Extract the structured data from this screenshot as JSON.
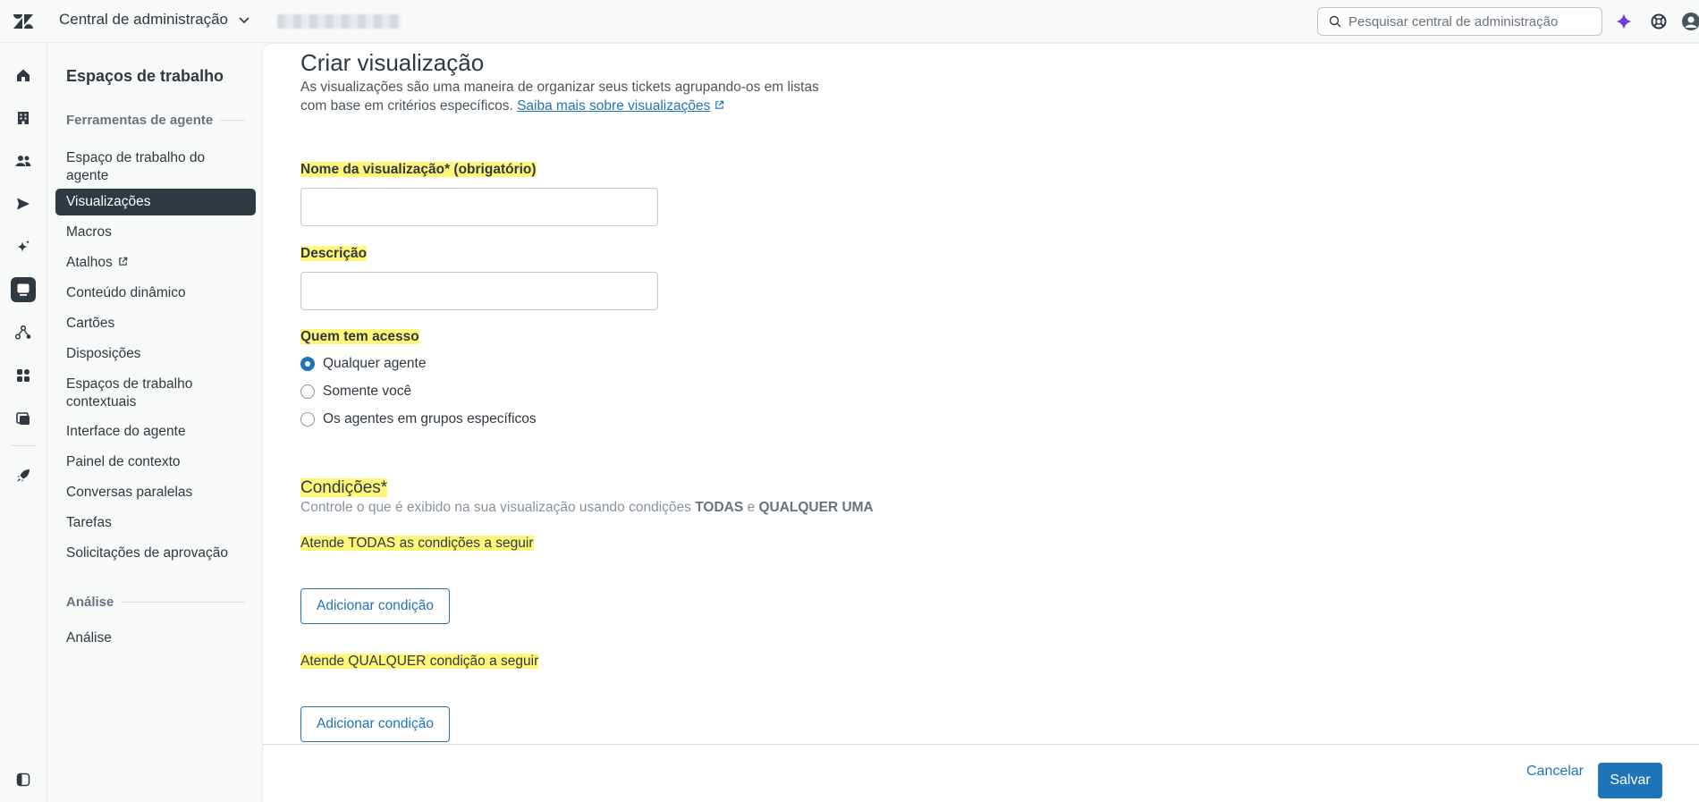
{
  "header": {
    "product_name": "Central de administração",
    "search_placeholder": "Pesquisar central de administração"
  },
  "rail": {
    "items": [
      "home-icon",
      "building-icon",
      "people-icon",
      "send-icon",
      "sparkle-icon",
      "workspaces-icon",
      "objects-icon",
      "apps-icon",
      "account-icon",
      "rocket-icon"
    ],
    "active": "workspaces-icon"
  },
  "sidebar": {
    "title": "Espaços de trabalho",
    "section_agent_tools": "Ferramentas de agente",
    "items": [
      {
        "label": "Espaço de trabalho do agente"
      },
      {
        "label": "Visualizações"
      },
      {
        "label": "Macros"
      },
      {
        "label": "Atalhos"
      },
      {
        "label": "Conteúdo dinâmico"
      },
      {
        "label": "Cartões"
      },
      {
        "label": "Disposições"
      },
      {
        "label": "Espaços de trabalho contextuais"
      },
      {
        "label": "Interface do agente"
      },
      {
        "label": "Painel de contexto"
      },
      {
        "label": "Conversas paralelas"
      },
      {
        "label": "Tarefas"
      },
      {
        "label": "Solicitações de aprovação"
      }
    ],
    "section_analysis": "Análise",
    "analysis_items": [
      {
        "label": "Análise"
      }
    ]
  },
  "main": {
    "title": "Criar visualização",
    "intro_text": "As visualizações são uma maneira de organizar seus tickets agrupando-os em listas com base em critérios específicos.",
    "intro_link": "Saiba mais sobre visualizações",
    "name_label": "Nome da visualização* (obrigatório)",
    "name_value": "",
    "description_label": "Descrição",
    "description_value": "",
    "access_label": "Quem tem acesso",
    "access_options": [
      "Qualquer agente",
      "Somente você",
      "Os agentes em grupos específicos"
    ],
    "access_selected": "Qualquer agente",
    "conditions_title": "Condições*",
    "conditions_desc_pre": "Controle o que é exibido na sua visualização usando condições",
    "conditions_desc_all": "TODAS",
    "conditions_desc_and": "e",
    "conditions_desc_any": "QUALQUER UMA",
    "all_label": "Atende TODAS as condições a seguir",
    "any_label": "Atende QUALQUER condição a seguir",
    "add_condition": "Adicionar condição"
  },
  "footer": {
    "cancel": "Cancelar",
    "save": "Salvar"
  },
  "colors": {
    "accent": "#1f73b7",
    "highlight": "#fff67a",
    "sidebar_active": "#2f3941"
  }
}
